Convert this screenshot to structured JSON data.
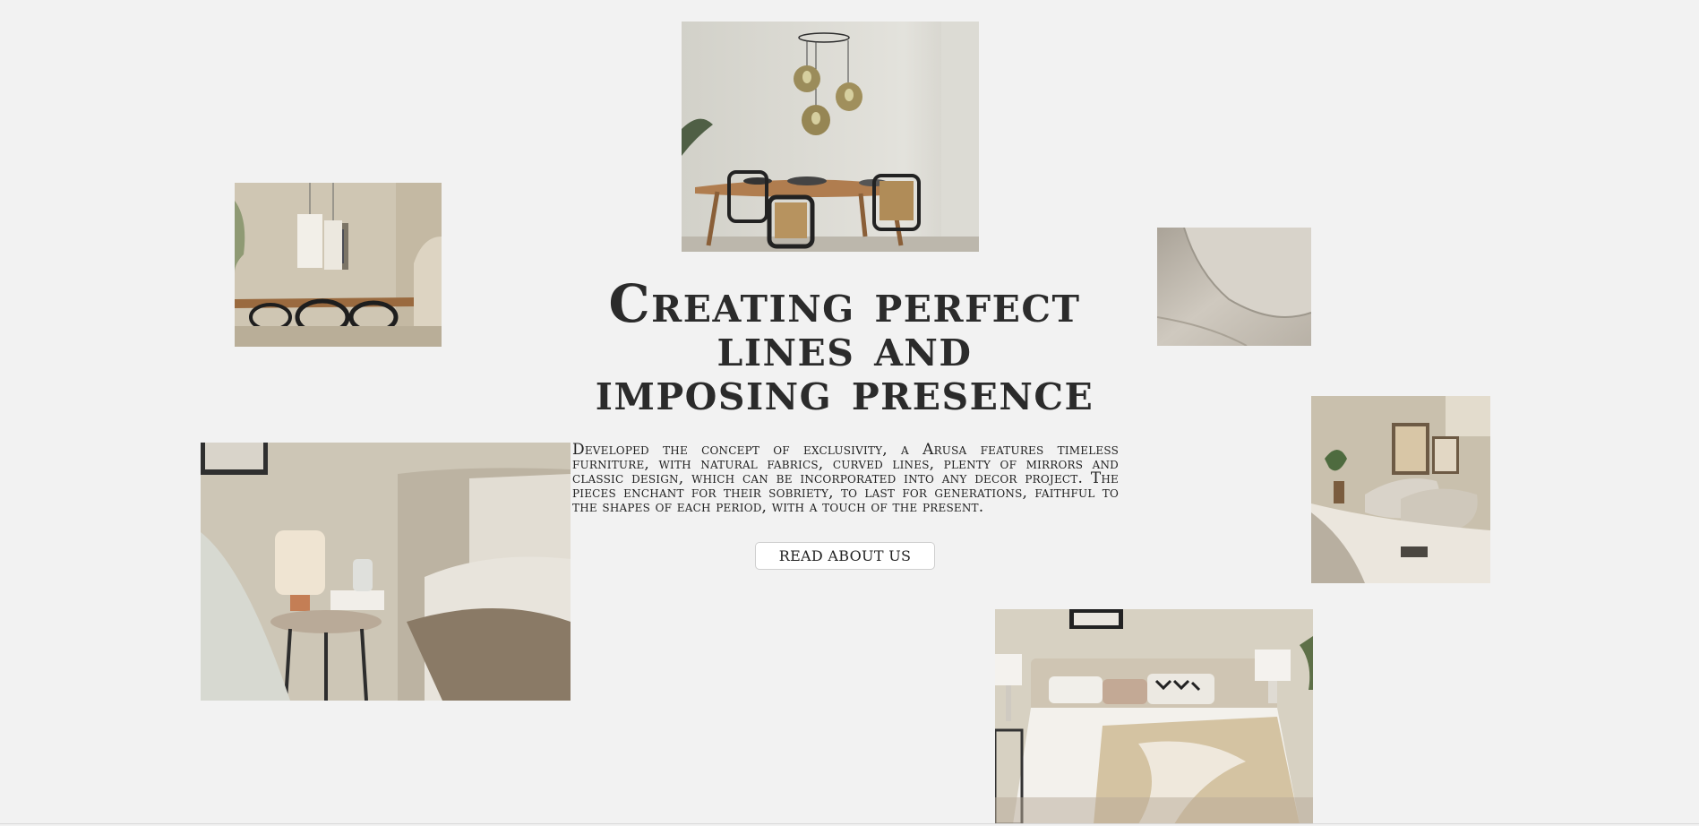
{
  "hero": {
    "headline_line1": "Creating perfect",
    "headline_line2": "lines and",
    "headline_line3": "imposing presence",
    "description": "Developed the concept of exclusivity, a Arusa features timeless furniture, with natural fabrics, curved lines, plenty of mirrors and classic design, which can be incorporated into any decor project. The pieces enchant for their sobriety, to last for generations, faithful to the shapes of each period, with a touch of the present.",
    "button_label": "READ ABOUT US"
  },
  "colors": {
    "background": "#f2f2f2",
    "text": "#2b2b2b",
    "button_bg": "#ffffff",
    "button_border": "#cfcfcf"
  }
}
